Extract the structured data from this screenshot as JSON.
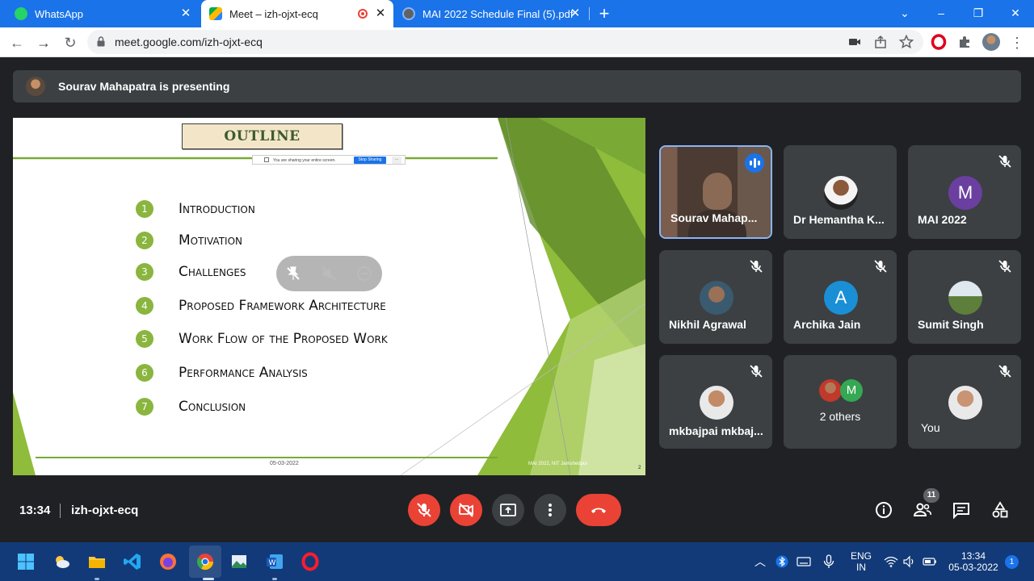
{
  "browser": {
    "tabs": [
      {
        "title": "WhatsApp",
        "active": false
      },
      {
        "title": "Meet – izh-ojxt-ecq",
        "active": true,
        "recording": true
      },
      {
        "title": "MAI 2022 Schedule Final (5).pdf",
        "active": false
      }
    ],
    "new_tab_label": "+",
    "url": "meet.google.com/izh-ojxt-ecq"
  },
  "meet": {
    "presenting_text": "Sourav Mahapatra is presenting",
    "slide": {
      "title": "OUTLINE",
      "share_notice": "You are sharing your entire screen.",
      "stop_sharing_label": "Stop Sharing",
      "share_more": "...",
      "items": [
        {
          "num": "1",
          "label": "Introduction"
        },
        {
          "num": "2",
          "label": "Motivation"
        },
        {
          "num": "3",
          "label": "Challenges"
        },
        {
          "num": "4",
          "label": "Proposed Framework Architecture"
        },
        {
          "num": "5",
          "label": "Work Flow of the Proposed Work"
        },
        {
          "num": "6",
          "label": "Performance Analysis"
        },
        {
          "num": "7",
          "label": "Conclusion"
        }
      ],
      "date": "05-03-2022",
      "footer": "MAI 2022, NIT Jamshedpur",
      "page": "2"
    },
    "participants": [
      {
        "name": "Sourav Mahap...",
        "kind": "video",
        "speaking": true
      },
      {
        "name": "Dr Hemantha K...",
        "kind": "photo",
        "muted": false
      },
      {
        "name": "MAI 2022",
        "kind": "letter",
        "letter": "M",
        "color": "#6b3fa0",
        "muted": true
      },
      {
        "name": "Nikhil Agrawal",
        "kind": "photo",
        "muted": true
      },
      {
        "name": "Archika Jain",
        "kind": "letter",
        "letter": "A",
        "color": "#1a8fd6",
        "muted": true
      },
      {
        "name": "Sumit Singh",
        "kind": "photo",
        "muted": true
      },
      {
        "name": "mkbajpai mkbaj...",
        "kind": "photo",
        "muted": true
      },
      {
        "name": "2 others",
        "kind": "group",
        "letter": "M",
        "color": "#34a853"
      },
      {
        "name": "You",
        "kind": "photo",
        "muted": true
      }
    ],
    "bottom": {
      "time": "13:34",
      "meeting_code": "izh-ojxt-ecq",
      "people_count": "11"
    }
  },
  "taskbar": {
    "lang_top": "ENG",
    "lang_bottom": "IN",
    "time": "13:34",
    "date": "05-03-2022",
    "notification_count": "1"
  }
}
